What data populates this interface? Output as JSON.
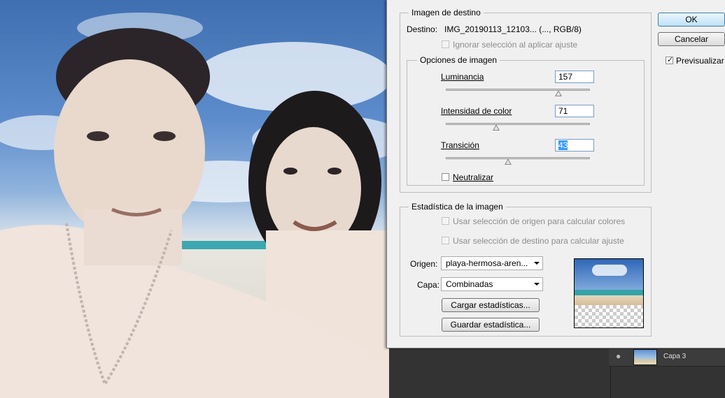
{
  "dialog": {
    "target_group": {
      "legend": "Imagen de destino",
      "destination_label": "Destino:",
      "destination_value": "IMG_20190113_12103... (..., RGB/8)",
      "ignore_selection": "Ignorar selección al aplicar ajuste"
    },
    "image_options": {
      "legend": "Opciones de imagen",
      "luminance": {
        "label": "Luminancia",
        "value": "157",
        "min": 1,
        "max": 200
      },
      "color_intensity": {
        "label": "Intensidad de color",
        "value": "71",
        "min": 1,
        "max": 200
      },
      "transition": {
        "label": "Transición",
        "value": "43",
        "min": 0,
        "max": 100
      },
      "neutralize": "Neutralizar"
    },
    "statistics": {
      "legend": "Estadística de la imagen",
      "use_source_selection": "Usar selección de origen para calcular colores",
      "use_target_selection": "Usar selección de destino para calcular ajuste",
      "source_label": "Origen:",
      "source_value": "playa-hermosa-aren...",
      "layer_label": "Capa:",
      "layer_value": "Combinadas",
      "load_button": "Cargar estadísticas...",
      "save_button": "Guardar estadística..."
    },
    "ok_button": "OK",
    "cancel_button": "Cancelar",
    "preview_label": "Previsualizar",
    "preview_checked": true
  },
  "layers_panel": {
    "layer_name": "Capa 3",
    "visibility_icon": "eye-icon"
  },
  "colors": {
    "dialog_bg": "#f0f0f0",
    "ok_accent": "#3c7fb1",
    "selection_highlight": "#3399ff"
  }
}
